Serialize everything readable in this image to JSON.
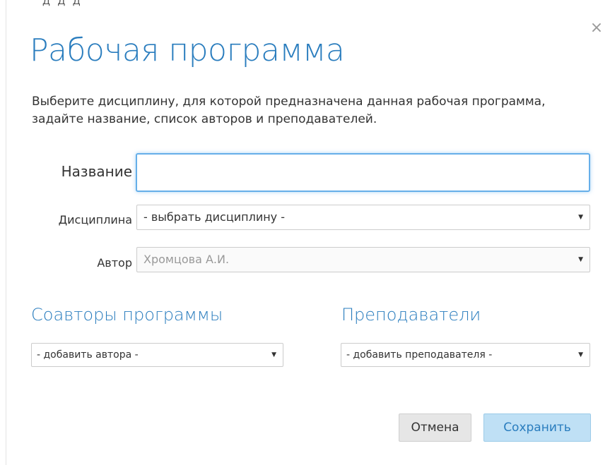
{
  "dialog": {
    "top_cut_text": "Д Д Д",
    "title": "Рабочая программа",
    "intro": "Выберите дисциплину, для которой предназначена данная рабочая программа, задайте название, список авторов и преподавателей.",
    "close_label": "×"
  },
  "form": {
    "name_label": "Название",
    "name_value": "",
    "discipline_label": "Дисциплина",
    "discipline_value": "- выбрать дисциплину -",
    "author_label": "Автор",
    "author_value": "Хромцова А.И."
  },
  "coauthors": {
    "title": "Соавторы программы",
    "select_value": "- добавить автора -"
  },
  "teachers": {
    "title": "Преподаватели",
    "select_value": "- добавить преподавателя -"
  },
  "buttons": {
    "cancel": "Отмена",
    "save": "Сохранить"
  },
  "icons": {
    "dropdown": "▼",
    "close": "close-icon"
  },
  "colors": {
    "accent": "#2a7dbe",
    "focus_border": "#66afe9",
    "save_bg": "#bfe0f5",
    "cancel_bg": "#e6e6e6"
  }
}
